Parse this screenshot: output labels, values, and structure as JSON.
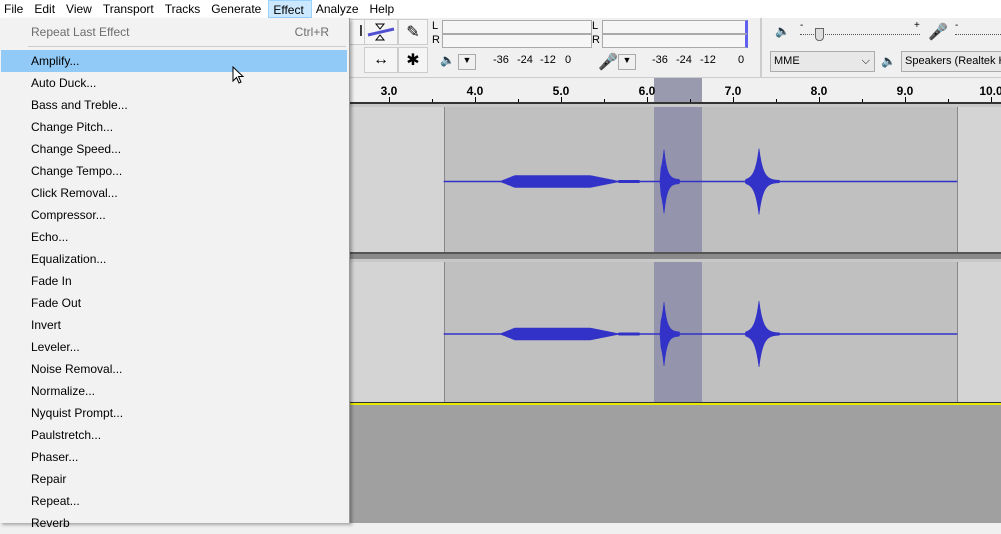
{
  "menubar": [
    "File",
    "Edit",
    "View",
    "Transport",
    "Tracks",
    "Generate",
    "Effect",
    "Analyze",
    "Help"
  ],
  "active_menu": "Effect",
  "effect_menu": {
    "repeat": {
      "label": "Repeat Last Effect",
      "shortcut": "Ctrl+R"
    },
    "items": [
      "Amplify...",
      "Auto Duck...",
      "Bass and Treble...",
      "Change Pitch...",
      "Change Speed...",
      "Change Tempo...",
      "Click Removal...",
      "Compressor...",
      "Echo...",
      "Equalization...",
      "Fade In",
      "Fade Out",
      "Invert",
      "Leveler...",
      "Noise Removal...",
      "Normalize...",
      "Nyquist Prompt...",
      "Paulstretch...",
      "Phaser...",
      "Repair",
      "Repeat...",
      "Reverb"
    ],
    "highlighted": "Amplify..."
  },
  "meters": {
    "channels": [
      "L",
      "R"
    ],
    "scale": [
      "-36",
      "-24",
      "-12",
      "0"
    ]
  },
  "mixer": {
    "minus": "-",
    "plus": "+"
  },
  "device": {
    "host": "MME",
    "output": "Speakers (Realtek H"
  },
  "ruler": {
    "ticks": [
      "3.0",
      "4.0",
      "5.0",
      "6.0",
      "7.0",
      "8.0",
      "9.0",
      "10.0"
    ]
  },
  "colors": {
    "waveform": "#3232c8",
    "selection": "#8c8ca8",
    "highlight": "#91c9f7"
  }
}
